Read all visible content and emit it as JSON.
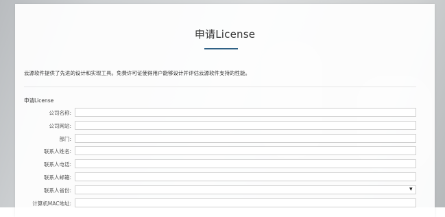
{
  "page": {
    "title": "申请License",
    "intro": "云源软件提供了先进的设计和实现工具。免费许可证使得用户能够设计并评估云源软件支持的性能。",
    "section_title": "申请License"
  },
  "form": {
    "fields": [
      {
        "label": "公司名称:",
        "value": "",
        "type": "text"
      },
      {
        "label": "公司网站:",
        "value": "",
        "type": "text"
      },
      {
        "label": "部门:",
        "value": "",
        "type": "text"
      },
      {
        "label": "联系人姓名:",
        "value": "",
        "type": "text"
      },
      {
        "label": "联系人电话:",
        "value": "",
        "type": "text"
      },
      {
        "label": "联系人邮箱:",
        "value": "",
        "type": "text"
      },
      {
        "label": "联系人省份:",
        "value": "",
        "type": "select"
      },
      {
        "label": "计算机MAC地址:",
        "value": "",
        "type": "text"
      }
    ]
  },
  "colors": {
    "accent": "#2f6185"
  }
}
